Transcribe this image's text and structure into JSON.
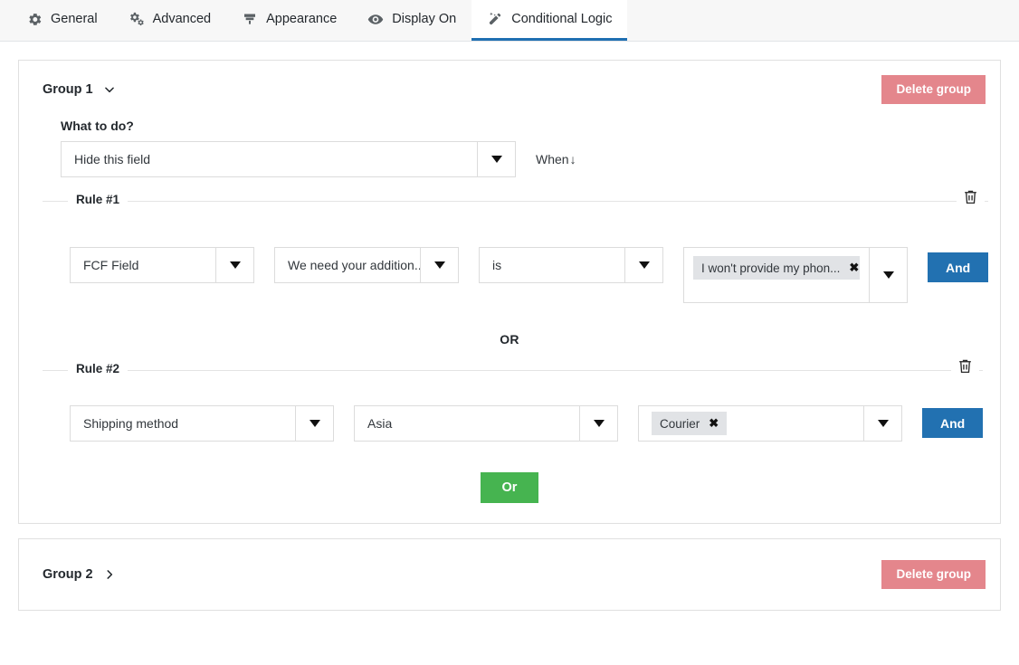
{
  "tabs": [
    {
      "label": "General",
      "icon": "gear-icon",
      "active": false
    },
    {
      "label": "Advanced",
      "icon": "gears-icon",
      "active": false
    },
    {
      "label": "Appearance",
      "icon": "paintbrush-icon",
      "active": false
    },
    {
      "label": "Display On",
      "icon": "eye-icon",
      "active": false
    },
    {
      "label": "Conditional Logic",
      "icon": "magic-wand-icon",
      "active": true
    }
  ],
  "colors": {
    "accent_blue": "#2271b1",
    "delete_red": "#e4868c",
    "or_green": "#46b450",
    "tab_underline": "#1f6fb2",
    "tag_bg": "#e1e3e6"
  },
  "group1": {
    "title": "Group 1",
    "collapse_icon": "chevron-down-icon",
    "delete_label": "Delete group",
    "what_to_do_label": "What to do?",
    "action_value": "Hide this field",
    "when_label": "When",
    "when_arrow": "↓",
    "rules": [
      {
        "legend": "Rule #1",
        "delete_icon": "trash-icon",
        "field_value": "FCF Field",
        "subfield_value": "We need your addition...",
        "operator_value": "is",
        "tags": [
          {
            "label": "I won't provide my phon...",
            "remove_icon": "close-icon"
          }
        ],
        "and_label": "And"
      },
      {
        "legend": "Rule #2",
        "delete_icon": "trash-icon",
        "field_value": "Shipping method",
        "subfield_value": "Asia",
        "tags": [
          {
            "label": "Courier",
            "remove_icon": "close-icon"
          }
        ],
        "and_label": "And"
      }
    ],
    "rule_separator": "OR",
    "add_or_label": "Or"
  },
  "group2": {
    "title": "Group 2",
    "collapse_icon": "chevron-right-icon",
    "delete_label": "Delete group"
  }
}
